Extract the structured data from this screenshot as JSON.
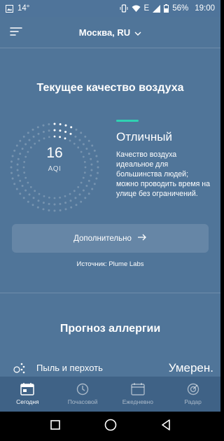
{
  "status_bar": {
    "temperature": "14°",
    "network": "E",
    "battery": "56%",
    "time": "19:00"
  },
  "header": {
    "city": "Москва, RU"
  },
  "air_quality": {
    "title": "Текущее качество воздуха",
    "aqi_value": "16",
    "aqi_label": "AQI",
    "status": "Отличный",
    "description": "Качество воздуха\nидеальное для\nбольшинства людей;\nможно проводить время на\nулице без ограничений.",
    "more_label": "Дополнительно",
    "source": "Источник: Plume Labs",
    "accent_color": "#2fd1b2"
  },
  "allergy": {
    "title": "Прогноз аллергии",
    "items": [
      {
        "name": "Пыль и перхоть",
        "level": "Умерен."
      }
    ]
  },
  "bottom_nav": {
    "items": [
      {
        "label": "Сегодня",
        "icon": "calendar-today-icon",
        "active": true
      },
      {
        "label": "Почасовой",
        "icon": "clock-icon",
        "active": false
      },
      {
        "label": "Ежедневно",
        "icon": "calendar-icon",
        "active": false
      },
      {
        "label": "Радар",
        "icon": "radar-icon",
        "active": false
      }
    ]
  },
  "colors": {
    "background": "#507599",
    "nav_background": "#3f6286"
  }
}
